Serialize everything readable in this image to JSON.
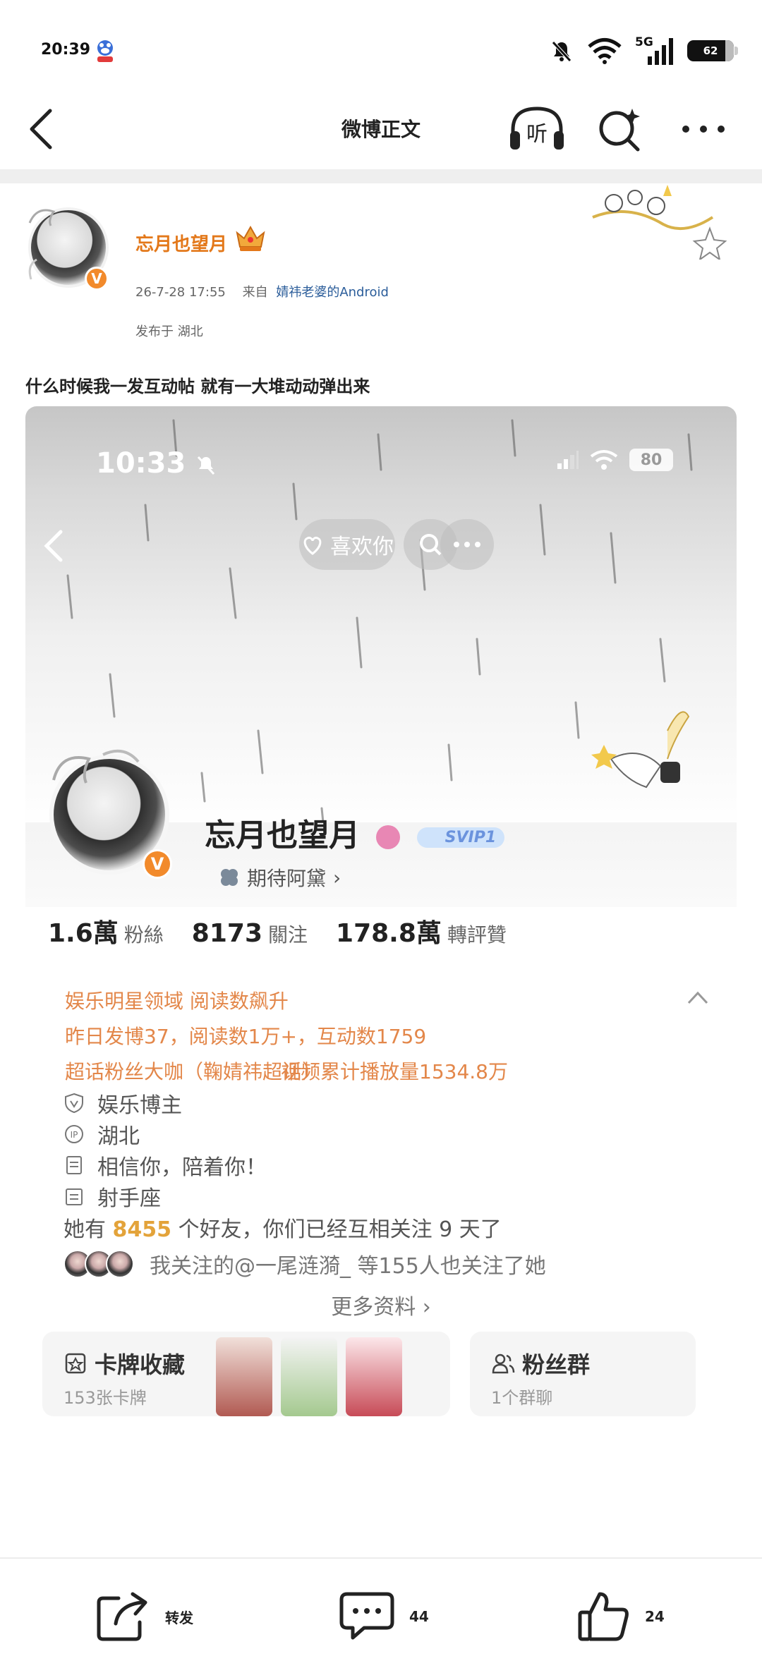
{
  "status_bar": {
    "time": "20:39",
    "network": "5G",
    "battery": "62",
    "icons": [
      "baidu-app-icon",
      "mute-icon",
      "wifi-icon",
      "signal-icon",
      "battery-icon"
    ]
  },
  "nav": {
    "title": "微博正文",
    "icons": [
      "back-icon",
      "listen-icon",
      "search-sparkle-icon",
      "more-icon"
    ]
  },
  "post": {
    "author": "忘月也望月",
    "time": "26-7-28 17:55",
    "from_label": "来自",
    "source": "婧祎老婆的Android",
    "location": "发布于 湖北",
    "text": "什么时候我一发互动帖 就有一大堆动动弹出来"
  },
  "embedded": {
    "time": "10:33",
    "battery": "80",
    "like_label": "喜欢你",
    "name": "忘月也望月",
    "svip": "SVIP1",
    "subtitle": "期待阿黛",
    "stats": [
      {
        "num": "1.6萬",
        "label": "粉絲"
      },
      {
        "num": "8173",
        "label": "關注"
      },
      {
        "num": "178.8萬",
        "label": "轉評贊"
      }
    ],
    "highlight_title": "娱乐明星领域 阅读数飙升",
    "highlight_line1": "昨日发博37，阅读数1万+，互动数1759",
    "highlight_line2a": "超话粉丝大咖（鞠婧祎超话）",
    "highlight_line2b": "视频累计播放量1534.8万",
    "info": [
      {
        "icon": "shield-v-icon",
        "text": "娱乐博主"
      },
      {
        "icon": "ip-icon",
        "text": "湖北"
      },
      {
        "icon": "document-icon",
        "text": "相信你，陪着你！"
      },
      {
        "icon": "calendar-icon",
        "text": "射手座"
      }
    ],
    "friends_prefix": "她有",
    "friends_count": "8455",
    "friends_suffix": "个好友，你们已经互相关注 9 天了",
    "mutual_text": "我关注的@一尾涟漪_ 等155人也关注了她",
    "more_label": "更多资料 ›",
    "card1_title": "卡牌收藏",
    "card1_sub": "153张卡牌",
    "card2_title": "粉丝群",
    "card2_sub": "1个群聊"
  },
  "bottom": {
    "repost": "转发",
    "comments": "44",
    "likes": "24"
  }
}
